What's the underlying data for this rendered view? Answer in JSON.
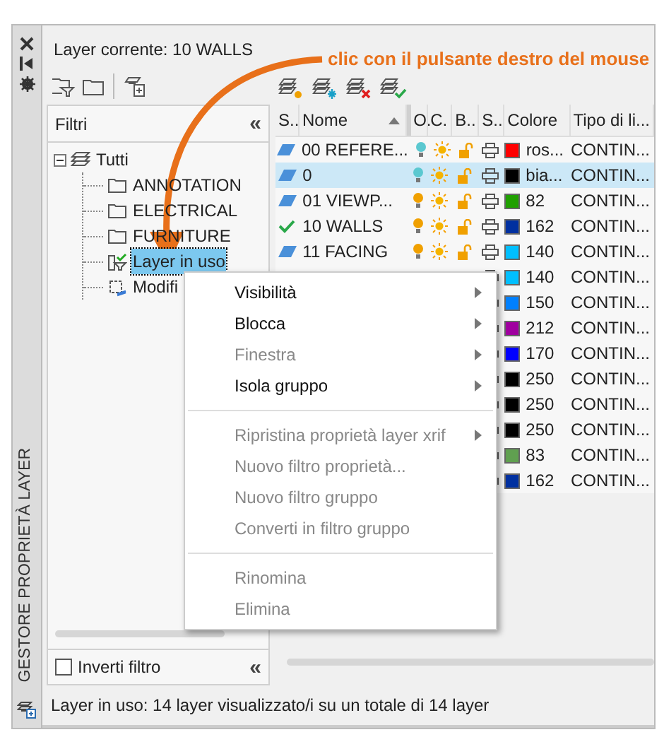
{
  "side_strip": {
    "title": "GESTORE PROPRIETÀ LAYER"
  },
  "current_layer": "Layer corrente: 10 WALLS",
  "annotation": "clic con il pulsante destro del mouse",
  "filters": {
    "title": "Filtri",
    "collapse": "«",
    "tree": [
      {
        "label": "Tutti",
        "kind": "all",
        "expanded": true,
        "selected": false,
        "children": [
          {
            "label": "ANNOTATION",
            "kind": "group",
            "selected": false
          },
          {
            "label": "ELECTRICAL",
            "kind": "group",
            "selected": false
          },
          {
            "label": "FURNITURE",
            "kind": "group",
            "selected": false
          },
          {
            "label": "Layer in uso",
            "kind": "filter",
            "selected": true
          },
          {
            "label": "Modifi",
            "kind": "changed",
            "selected": false
          }
        ]
      }
    ],
    "invert": {
      "label": "Inverti filtro",
      "checked": false
    },
    "invert_collapse": "«"
  },
  "table": {
    "columns": [
      "S..",
      "Nome",
      "O.",
      "C.",
      "B..",
      "S..",
      "Colore",
      "Tipo di li..."
    ],
    "rows": [
      {
        "kind": "layer",
        "name": "00  REFERE...",
        "bulb": {
          "color": "#5bc8d0"
        },
        "color": "#ff0000",
        "color_name": "ros...",
        "linetype": "CONTIN...",
        "selected": false
      },
      {
        "kind": "layer",
        "name": "0",
        "bulb": {
          "color": "#5bc8d0"
        },
        "color": "#000000",
        "color_name": "bia...",
        "linetype": "CONTIN...",
        "selected": true
      },
      {
        "kind": "layer",
        "name": "01  VIEWP...",
        "bulb": {
          "color": "#f0a000"
        },
        "color": "#20a000",
        "color_name": "82",
        "linetype": "CONTIN...",
        "selected": false
      },
      {
        "kind": "current",
        "name": "10 WALLS",
        "bulb": {
          "color": "#f0a000"
        },
        "color": "#0030a0",
        "color_name": "162",
        "linetype": "CONTIN...",
        "selected": false
      },
      {
        "kind": "layer",
        "name": "11 FACING",
        "bulb": {
          "color": "#f0a000"
        },
        "color": "#00bfff",
        "color_name": "140",
        "linetype": "CONTIN...",
        "selected": false
      },
      {
        "color": "#00bfff",
        "color_name": "140",
        "linetype": "CONTIN...",
        "selected": false
      },
      {
        "color": "#0080ff",
        "color_name": "150",
        "linetype": "CONTIN...",
        "selected": false
      },
      {
        "color": "#a000a0",
        "color_name": "212",
        "linetype": "CONTIN...",
        "selected": false
      },
      {
        "color": "#0000ff",
        "color_name": "170",
        "linetype": "CONTIN...",
        "selected": false
      },
      {
        "color": "#000000",
        "color_name": "250",
        "linetype": "CONTIN...",
        "selected": false
      },
      {
        "color": "#000000",
        "color_name": "250",
        "linetype": "CONTIN...",
        "selected": false
      },
      {
        "color": "#000000",
        "color_name": "250",
        "linetype": "CONTIN...",
        "selected": false
      },
      {
        "color": "#60a050",
        "color_name": "83",
        "linetype": "CONTIN...",
        "selected": false
      },
      {
        "color": "#0030a0",
        "color_name": "162",
        "linetype": "CONTIN...",
        "selected": false
      }
    ]
  },
  "context_menu": [
    {
      "kind": "item",
      "label": "Visibilità",
      "disabled": false,
      "submenu": true
    },
    {
      "kind": "item",
      "label": "Blocca",
      "disabled": false,
      "submenu": true
    },
    {
      "kind": "item",
      "label": "Finestra",
      "disabled": true,
      "submenu": true
    },
    {
      "kind": "item",
      "label": "Isola gruppo",
      "disabled": false,
      "submenu": true
    },
    {
      "kind": "separator"
    },
    {
      "kind": "item",
      "label": "Ripristina proprietà layer xrif",
      "disabled": true,
      "submenu": true
    },
    {
      "kind": "item",
      "label": "Nuovo filtro proprietà...",
      "disabled": true,
      "submenu": false
    },
    {
      "kind": "item",
      "label": "Nuovo filtro gruppo",
      "disabled": true,
      "submenu": false
    },
    {
      "kind": "item",
      "label": "Converti in filtro gruppo",
      "disabled": true,
      "submenu": false
    },
    {
      "kind": "separator"
    },
    {
      "kind": "item",
      "label": "Rinomina",
      "disabled": true,
      "submenu": false
    },
    {
      "kind": "item",
      "label": "Elimina",
      "disabled": true,
      "submenu": false
    }
  ],
  "status_bar": "Layer in uso: 14 layer visualizzato/i su un totale di 14 layer"
}
